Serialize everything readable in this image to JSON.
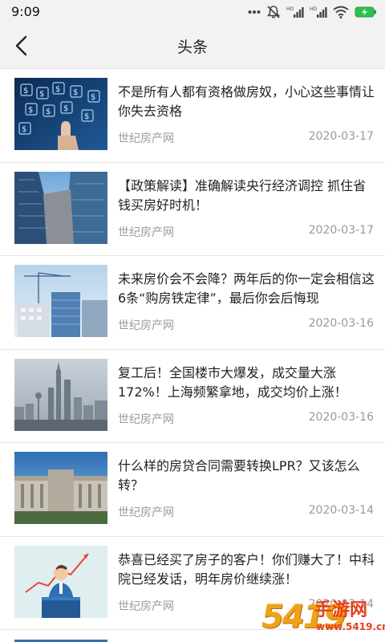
{
  "status_bar": {
    "time": "9:09",
    "icons": [
      "more-dots-icon",
      "mute-icon",
      "signal-hd-icon",
      "signal-hd-icon",
      "wifi-icon",
      "battery-charging-icon"
    ]
  },
  "header": {
    "back_icon": "chevron-left-icon",
    "title": "头条"
  },
  "articles": [
    {
      "title": "不是所有人都有资格做房奴，小心这些事情让你失去资格",
      "source": "世纪房产网",
      "date": "2020-03-17",
      "image": "finance-touch-image"
    },
    {
      "title": "【政策解读】准确解读央行经济调控 抓住省钱买房好时机！",
      "source": "世纪房产网",
      "date": "2020-03-17",
      "image": "skyscraper-image"
    },
    {
      "title": "未来房价会不会降？两年后的你一定会相信这6条“购房铁定律”，最后你会后悔现",
      "source": "世纪房产网",
      "date": "2020-03-16",
      "image": "construction-crane-image"
    },
    {
      "title": "复工后！全国楼市大爆发，成交量大涨172%！上海频繁拿地，成交均价上涨！",
      "source": "世纪房产网",
      "date": "2020-03-16",
      "image": "city-skyline-image"
    },
    {
      "title": "什么样的房贷合同需要转换LPR？又该怎么转？",
      "source": "世纪房产网",
      "date": "2020-03-14",
      "image": "central-bank-building-image"
    },
    {
      "title": "恭喜已经买了房子的客户！你们赚大了！中科院已经发话，明年房价继续涨！",
      "source": "世纪房产网",
      "date": "2020-03-14",
      "image": "speaker-chart-image"
    }
  ],
  "watermark": {
    "number": "5419",
    "brand": "手游网",
    "site": "www.5419.cn"
  },
  "colors": {
    "header_bg": "#f2f2f2",
    "meta_text": "#9a9a9a",
    "divider": "#e6e6e6"
  }
}
